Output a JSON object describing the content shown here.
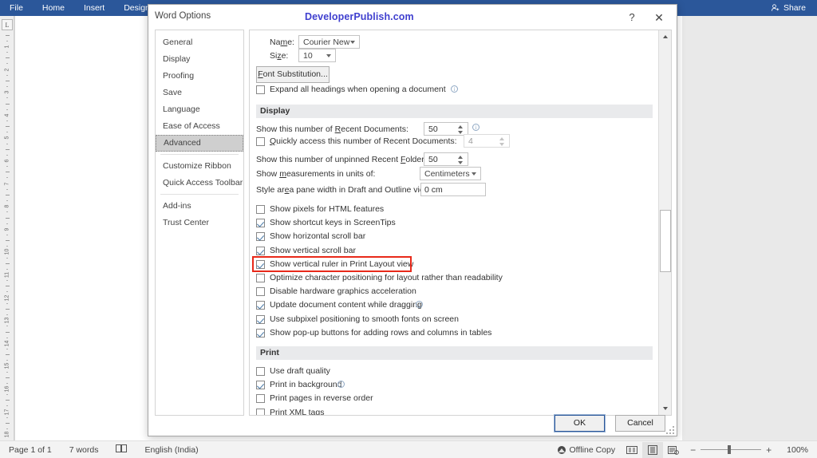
{
  "ribbon": {
    "tabs": [
      "File",
      "Home",
      "Insert",
      "Design"
    ],
    "share_label": "Share"
  },
  "dialog": {
    "title": "Word Options",
    "watermark": "DeveloperPublish.com",
    "help_glyph": "?",
    "close_glyph": "✕",
    "nav": {
      "items": [
        {
          "label": "General",
          "selected": false
        },
        {
          "label": "Display",
          "selected": false
        },
        {
          "label": "Proofing",
          "selected": false
        },
        {
          "label": "Save",
          "selected": false
        },
        {
          "label": "Language",
          "selected": false
        },
        {
          "label": "Ease of Access",
          "selected": false
        },
        {
          "label": "Advanced",
          "selected": true
        },
        {
          "label": "Customize Ribbon",
          "selected": false
        },
        {
          "label": "Quick Access Toolbar",
          "selected": false
        },
        {
          "label": "Add-ins",
          "selected": false
        },
        {
          "label": "Trust Center",
          "selected": false
        }
      ]
    },
    "font_block": {
      "name_label": "Name:",
      "name_value": "Courier New",
      "size_label": "Size:",
      "size_value": "10",
      "font_substitution_label": "Font Substitution...",
      "expand_headings_label": "Expand all headings when opening a document",
      "expand_headings_checked": false
    },
    "display_section": {
      "heading": "Display",
      "recent_documents_label": "Show this number of Recent Documents:",
      "recent_documents_value": "50",
      "quick_access_label": "Quickly access this number of Recent Documents:",
      "quick_access_value": "4",
      "quick_access_checked": false,
      "unpinned_folders_label": "Show this number of unpinned Recent Folders:",
      "unpinned_folders_value": "50",
      "measurements_label": "Show measurements in units of:",
      "measurements_value": "Centimeters",
      "style_pane_label": "Style area pane width in Draft and Outline views:",
      "style_pane_value": "0 cm",
      "checkboxes": [
        {
          "label": "Show pixels for HTML features",
          "checked": false,
          "info": false,
          "highlighted": false
        },
        {
          "label": "Show shortcut keys in ScreenTips",
          "checked": true,
          "info": false,
          "highlighted": false
        },
        {
          "label": "Show horizontal scroll bar",
          "checked": true,
          "info": false,
          "highlighted": false
        },
        {
          "label": "Show vertical scroll bar",
          "checked": true,
          "info": false,
          "highlighted": false
        },
        {
          "label": "Show vertical ruler in Print Layout view",
          "checked": true,
          "info": false,
          "highlighted": true
        },
        {
          "label": "Optimize character positioning for layout rather than readability",
          "checked": false,
          "info": false,
          "highlighted": false
        },
        {
          "label": "Disable hardware graphics acceleration",
          "checked": false,
          "info": false,
          "highlighted": false
        },
        {
          "label": "Update document content while dragging",
          "checked": true,
          "info": true,
          "highlighted": false
        },
        {
          "label": "Use subpixel positioning to smooth fonts on screen",
          "checked": true,
          "info": false,
          "highlighted": false
        },
        {
          "label": "Show pop-up buttons for adding rows and columns in tables",
          "checked": true,
          "info": false,
          "highlighted": false
        }
      ]
    },
    "print_section": {
      "heading": "Print",
      "checkboxes": [
        {
          "label": "Use draft quality",
          "checked": false,
          "info": false
        },
        {
          "label": "Print in background",
          "checked": true,
          "info": true
        },
        {
          "label": "Print pages in reverse order",
          "checked": false,
          "info": false
        },
        {
          "label": "Print XML tags",
          "checked": false,
          "info": false
        }
      ]
    },
    "ok_label": "OK",
    "cancel_label": "Cancel"
  },
  "ruler": {
    "corner_glyph": "L",
    "numbers": [
      "1",
      "2",
      "3",
      "4",
      "5",
      "6",
      "7",
      "8",
      "9",
      "10",
      "11",
      "12",
      "13",
      "14",
      "15",
      "16",
      "17",
      "18"
    ]
  },
  "status_bar": {
    "page": "Page 1 of 1",
    "words": "7 words",
    "language": "English (India)",
    "offline": "Offline Copy",
    "zoom": "100%",
    "zoom_out_glyph": "−",
    "zoom_in_glyph": "+"
  }
}
